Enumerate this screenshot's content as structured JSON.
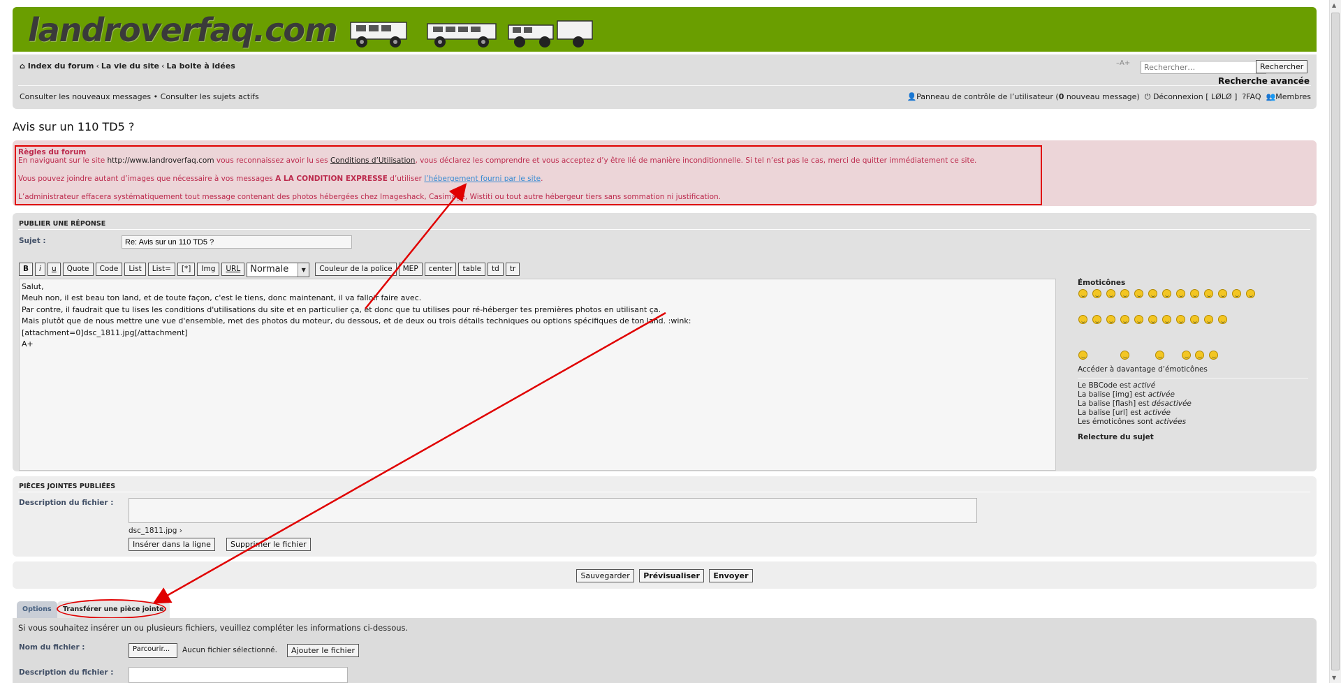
{
  "header": {
    "logo": "landroverfaq.com",
    "colors": {
      "brand": "#6a9e00",
      "rules_bg": "#ecd5d8",
      "rules_text": "#bc2a4d",
      "annotation": "#e00000"
    }
  },
  "breadcrumb": {
    "items": [
      "Index du forum",
      "La vie du site",
      "La boite à idées"
    ],
    "separator": "‹"
  },
  "search": {
    "font_size_tool": "–A+",
    "placeholder": "Rechercher…",
    "button": "Rechercher",
    "advanced": "Recherche avancée"
  },
  "nav": {
    "new_messages": "Consulter les nouveaux messages",
    "bullet": "•",
    "active_topics": "Consulter les sujets actifs",
    "ucp": "Panneau de contrôle de l’utilisateur (",
    "ucp_count": "0",
    "ucp_suffix": " nouveau message)",
    "logout": "Déconnexion [ LØLØ ]",
    "faq": "FAQ",
    "members": "Membres"
  },
  "topic_title": "Avis sur un 110 TD5 ?",
  "rules": {
    "title": "Règles du forum",
    "line1_a": "En naviguant sur le site ",
    "line1_url": "http://www.landroverfaq.com",
    "line1_b": " vous reconnaissez avoir lu ses ",
    "line1_terms": "Conditions d’Utilisation",
    "line1_c": ", vous déclarez les comprendre et vous acceptez d’y être lié de manière inconditionnelle. Si tel n’est pas le cas, merci de quitter immédiatement ce site.",
    "line2_a": "Vous pouvez joindre autant d’images que nécessaire à vos messages ",
    "line2_bold": "A LA CONDITION EXPRESSE",
    "line2_b": " d’utiliser ",
    "line2_link": "l’hébergement fourni par le site",
    "line2_c": ".",
    "line3": "L’administrateur effacera systématiquement tout message contenant des photos hébergées chez Imageshack, Casimage, Wistiti ou tout autre hébergeur tiers sans sommation ni justification."
  },
  "post": {
    "section_title": "PUBLIER UNE RÉPONSE",
    "subject_label": "Sujet :",
    "subject_value": "Re: Avis sur un 110 TD5 ?",
    "toolbar": [
      "B",
      "i",
      "u",
      "Quote",
      "Code",
      "List",
      "List=",
      "[*]",
      "Img",
      "URL"
    ],
    "font_size": "Normale",
    "toolbar2": [
      "Couleur de la police",
      "MEP",
      "center",
      "table",
      "td",
      "tr"
    ],
    "message_lines": [
      "Salut,",
      "Meuh non, il est beau ton land, et de toute façon, c'est le tiens, donc maintenant, il va falloir faire avec.",
      "Par contre, il faudrait que tu lises les conditions d'utilisations du site et en particulier ça, et donc que tu utilises pour ré-héberger tes premières photos en utilisant ça.",
      "Mais plutôt que de nous mettre une vue d'ensemble, met des photos du moteur, du dessous, et de deux ou trois détails techniques ou options spécifiques de ton land. :wink:",
      "[attachment=0]dsc_1811.jpg[/attachment]",
      "A+"
    ],
    "smilies_title": "Émoticônes",
    "smilies_more": "Accéder à davantage d’émoticônes",
    "bbcode_status": [
      {
        "a": "Le BBCode est ",
        "b": "activé"
      },
      {
        "a": "La balise [img] est ",
        "b": "activée"
      },
      {
        "a": "La balise [flash] est ",
        "b": "désactivée"
      },
      {
        "a": "La balise [url] est ",
        "b": "activée"
      },
      {
        "a": "Les émoticônes sont ",
        "b": "activées"
      }
    ],
    "topic_review": "Relecture du sujet"
  },
  "attachments": {
    "section_title": "PIÈCES JOINTES PUBLIÉES",
    "desc_label": "Description du fichier :",
    "file_name": "dsc_1811.jpg ›",
    "insert_btn": "Insérer dans la ligne",
    "delete_btn": "Supprimer le fichier"
  },
  "submit": {
    "save": "Sauvegarder",
    "preview": "Prévisualiser",
    "send": "Envoyer"
  },
  "tabs": {
    "options": "Options",
    "upload": "Transférer une pièce jointe"
  },
  "upload": {
    "intro": "Si vous souhaitez insérer un ou plusieurs fichiers, veuillez compléter les informations ci-dessous.",
    "name_label": "Nom du fichier :",
    "browse": "Parcourir...",
    "no_file": "Aucun fichier sélectionné.",
    "add_btn": "Ajouter le fichier",
    "desc_label": "Description du fichier :"
  }
}
